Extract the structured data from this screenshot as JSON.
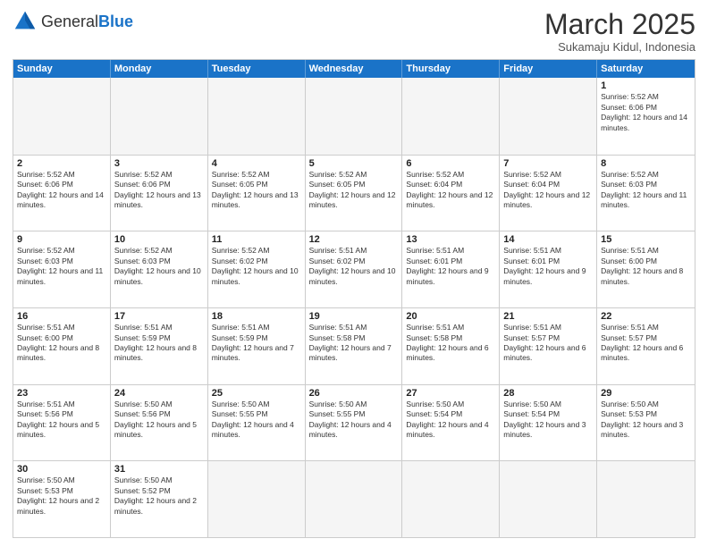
{
  "header": {
    "logo_general": "General",
    "logo_blue": "Blue",
    "month_title": "March 2025",
    "location": "Sukamaju Kidul, Indonesia"
  },
  "days_of_week": [
    "Sunday",
    "Monday",
    "Tuesday",
    "Wednesday",
    "Thursday",
    "Friday",
    "Saturday"
  ],
  "weeks": [
    [
      {
        "day": "",
        "info": "",
        "empty": true
      },
      {
        "day": "",
        "info": "",
        "empty": true
      },
      {
        "day": "",
        "info": "",
        "empty": true
      },
      {
        "day": "",
        "info": "",
        "empty": true
      },
      {
        "day": "",
        "info": "",
        "empty": true
      },
      {
        "day": "",
        "info": "",
        "empty": true
      },
      {
        "day": "1",
        "info": "Sunrise: 5:52 AM\nSunset: 6:06 PM\nDaylight: 12 hours and 14 minutes."
      }
    ],
    [
      {
        "day": "2",
        "info": "Sunrise: 5:52 AM\nSunset: 6:06 PM\nDaylight: 12 hours and 14 minutes."
      },
      {
        "day": "3",
        "info": "Sunrise: 5:52 AM\nSunset: 6:06 PM\nDaylight: 12 hours and 13 minutes."
      },
      {
        "day": "4",
        "info": "Sunrise: 5:52 AM\nSunset: 6:05 PM\nDaylight: 12 hours and 13 minutes."
      },
      {
        "day": "5",
        "info": "Sunrise: 5:52 AM\nSunset: 6:05 PM\nDaylight: 12 hours and 12 minutes."
      },
      {
        "day": "6",
        "info": "Sunrise: 5:52 AM\nSunset: 6:04 PM\nDaylight: 12 hours and 12 minutes."
      },
      {
        "day": "7",
        "info": "Sunrise: 5:52 AM\nSunset: 6:04 PM\nDaylight: 12 hours and 12 minutes."
      },
      {
        "day": "8",
        "info": "Sunrise: 5:52 AM\nSunset: 6:03 PM\nDaylight: 12 hours and 11 minutes."
      }
    ],
    [
      {
        "day": "9",
        "info": "Sunrise: 5:52 AM\nSunset: 6:03 PM\nDaylight: 12 hours and 11 minutes."
      },
      {
        "day": "10",
        "info": "Sunrise: 5:52 AM\nSunset: 6:03 PM\nDaylight: 12 hours and 10 minutes."
      },
      {
        "day": "11",
        "info": "Sunrise: 5:52 AM\nSunset: 6:02 PM\nDaylight: 12 hours and 10 minutes."
      },
      {
        "day": "12",
        "info": "Sunrise: 5:51 AM\nSunset: 6:02 PM\nDaylight: 12 hours and 10 minutes."
      },
      {
        "day": "13",
        "info": "Sunrise: 5:51 AM\nSunset: 6:01 PM\nDaylight: 12 hours and 9 minutes."
      },
      {
        "day": "14",
        "info": "Sunrise: 5:51 AM\nSunset: 6:01 PM\nDaylight: 12 hours and 9 minutes."
      },
      {
        "day": "15",
        "info": "Sunrise: 5:51 AM\nSunset: 6:00 PM\nDaylight: 12 hours and 8 minutes."
      }
    ],
    [
      {
        "day": "16",
        "info": "Sunrise: 5:51 AM\nSunset: 6:00 PM\nDaylight: 12 hours and 8 minutes."
      },
      {
        "day": "17",
        "info": "Sunrise: 5:51 AM\nSunset: 5:59 PM\nDaylight: 12 hours and 8 minutes."
      },
      {
        "day": "18",
        "info": "Sunrise: 5:51 AM\nSunset: 5:59 PM\nDaylight: 12 hours and 7 minutes."
      },
      {
        "day": "19",
        "info": "Sunrise: 5:51 AM\nSunset: 5:58 PM\nDaylight: 12 hours and 7 minutes."
      },
      {
        "day": "20",
        "info": "Sunrise: 5:51 AM\nSunset: 5:58 PM\nDaylight: 12 hours and 6 minutes."
      },
      {
        "day": "21",
        "info": "Sunrise: 5:51 AM\nSunset: 5:57 PM\nDaylight: 12 hours and 6 minutes."
      },
      {
        "day": "22",
        "info": "Sunrise: 5:51 AM\nSunset: 5:57 PM\nDaylight: 12 hours and 6 minutes."
      }
    ],
    [
      {
        "day": "23",
        "info": "Sunrise: 5:51 AM\nSunset: 5:56 PM\nDaylight: 12 hours and 5 minutes."
      },
      {
        "day": "24",
        "info": "Sunrise: 5:50 AM\nSunset: 5:56 PM\nDaylight: 12 hours and 5 minutes."
      },
      {
        "day": "25",
        "info": "Sunrise: 5:50 AM\nSunset: 5:55 PM\nDaylight: 12 hours and 4 minutes."
      },
      {
        "day": "26",
        "info": "Sunrise: 5:50 AM\nSunset: 5:55 PM\nDaylight: 12 hours and 4 minutes."
      },
      {
        "day": "27",
        "info": "Sunrise: 5:50 AM\nSunset: 5:54 PM\nDaylight: 12 hours and 4 minutes."
      },
      {
        "day": "28",
        "info": "Sunrise: 5:50 AM\nSunset: 5:54 PM\nDaylight: 12 hours and 3 minutes."
      },
      {
        "day": "29",
        "info": "Sunrise: 5:50 AM\nSunset: 5:53 PM\nDaylight: 12 hours and 3 minutes."
      }
    ],
    [
      {
        "day": "30",
        "info": "Sunrise: 5:50 AM\nSunset: 5:53 PM\nDaylight: 12 hours and 2 minutes."
      },
      {
        "day": "31",
        "info": "Sunrise: 5:50 AM\nSunset: 5:52 PM\nDaylight: 12 hours and 2 minutes."
      },
      {
        "day": "",
        "info": "",
        "empty": true
      },
      {
        "day": "",
        "info": "",
        "empty": true
      },
      {
        "day": "",
        "info": "",
        "empty": true
      },
      {
        "day": "",
        "info": "",
        "empty": true
      },
      {
        "day": "",
        "info": "",
        "empty": true
      }
    ]
  ]
}
